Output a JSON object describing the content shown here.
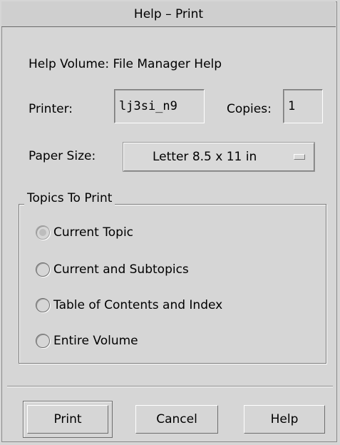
{
  "window": {
    "title": "Help – Print"
  },
  "help_volume": {
    "label": "Help Volume: File Manager Help"
  },
  "printer": {
    "label": "Printer:",
    "value": "lj3si_n9"
  },
  "copies": {
    "label": "Copies:",
    "value": "1"
  },
  "paper_size": {
    "label": "Paper Size:",
    "selected": "Letter 8.5 x 11 in"
  },
  "topics": {
    "title": "Topics To Print",
    "options": [
      {
        "label": "Current Topic",
        "checked": true
      },
      {
        "label": "Current and Subtopics",
        "checked": false
      },
      {
        "label": "Table of Contents and Index",
        "checked": false
      },
      {
        "label": "Entire Volume",
        "checked": false
      }
    ]
  },
  "buttons": {
    "print": "Print",
    "cancel": "Cancel",
    "help": "Help"
  }
}
